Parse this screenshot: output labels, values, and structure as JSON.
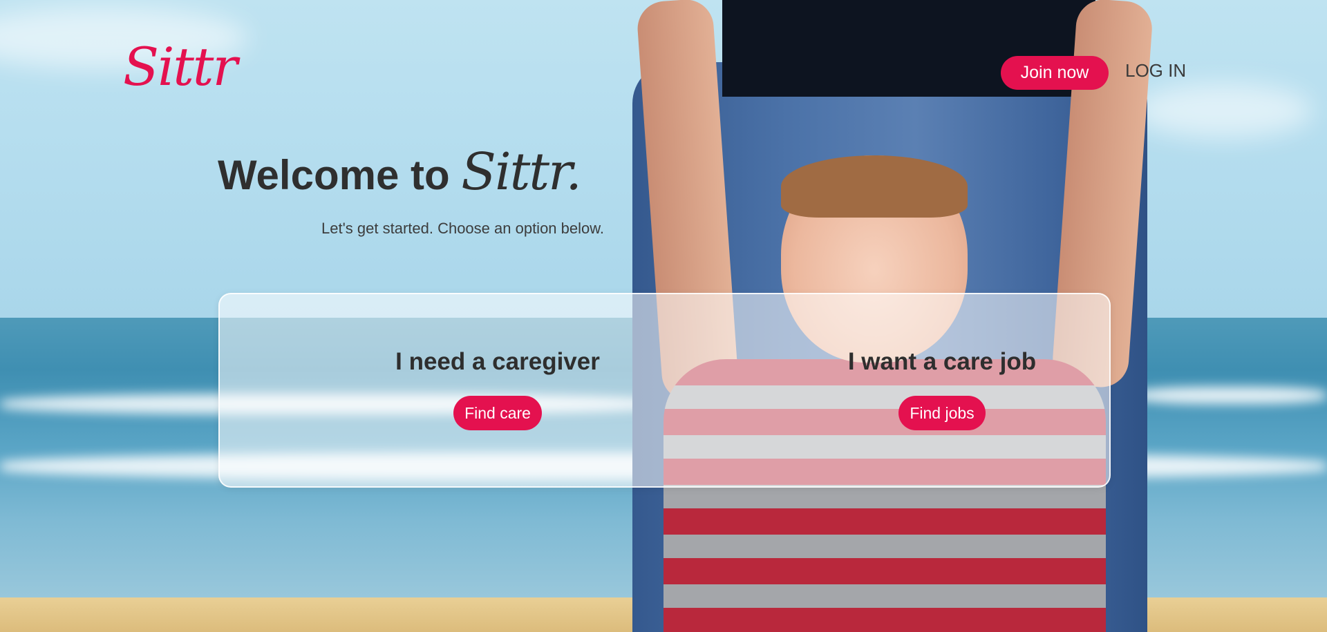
{
  "header": {
    "logo": "Sittr",
    "join_label": "Join now",
    "login_label": "LOG IN"
  },
  "hero": {
    "title_prefix": "Welcome to",
    "title_brand": "Sittr.",
    "subtitle": "Let's get started. Choose an option below."
  },
  "options": [
    {
      "heading": "I need a caregiver",
      "button": "Find care"
    },
    {
      "heading": "I want a care job",
      "button": "Find jobs"
    }
  ],
  "colors": {
    "brand": "#e4114f",
    "text": "#2f2f2f"
  }
}
